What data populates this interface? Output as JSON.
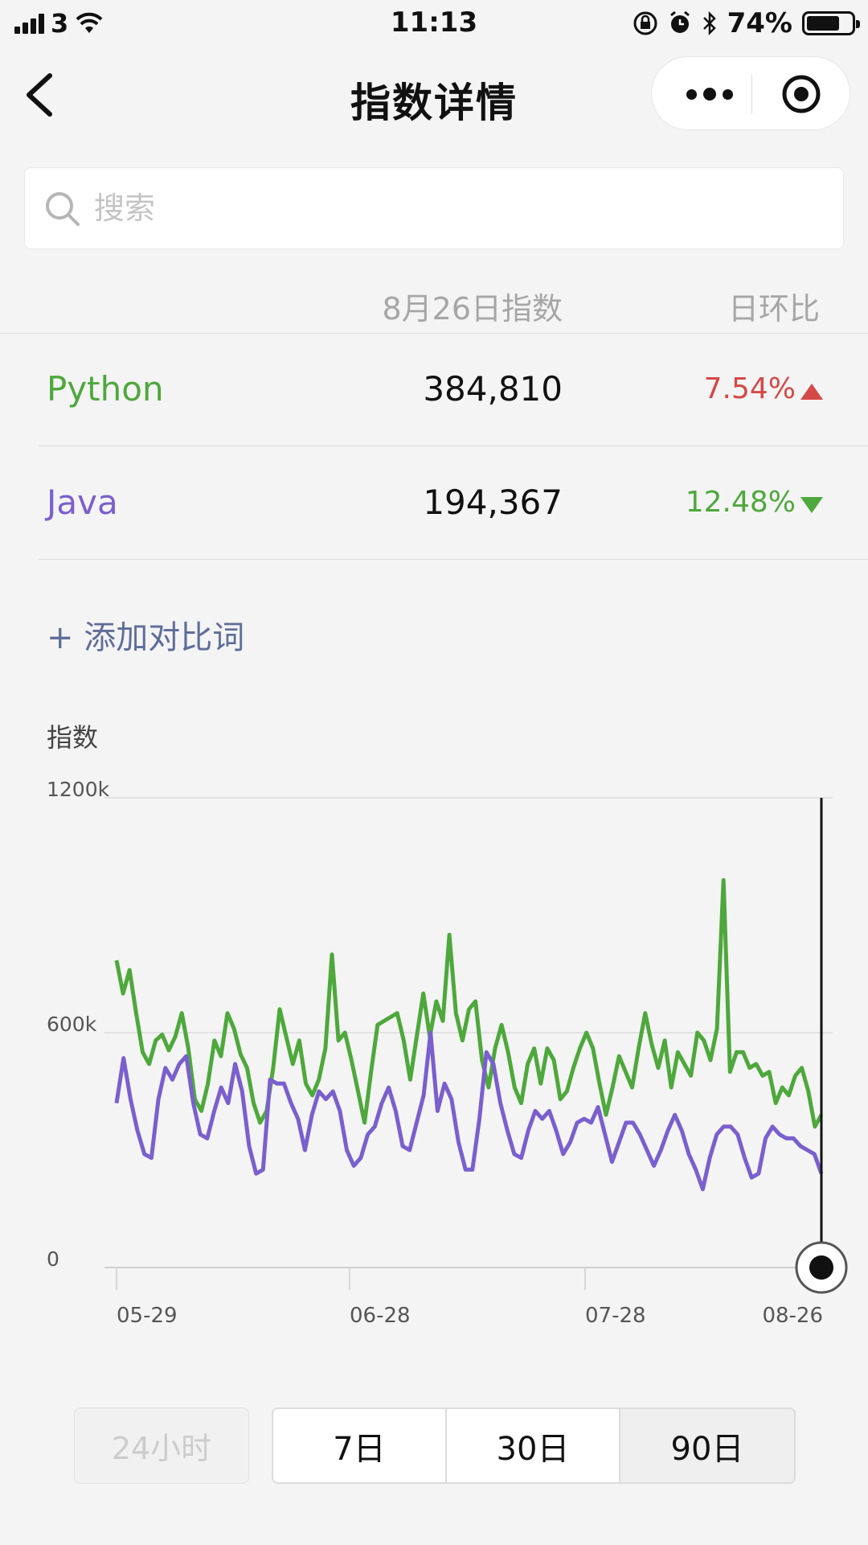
{
  "status_bar": {
    "carrier": "3",
    "time": "11:13",
    "battery": "74%"
  },
  "nav": {
    "title": "指数详情"
  },
  "search": {
    "placeholder": "搜索"
  },
  "table": {
    "header_index": "8月26日指数",
    "header_change": "日环比",
    "rows": [
      {
        "name": "Python",
        "value": "384,810",
        "change": "7.54%",
        "direction": "up",
        "color": "#4ea83c",
        "change_color": "#d34a47"
      },
      {
        "name": "Java",
        "value": "194,367",
        "change": "12.48%",
        "direction": "down",
        "color": "#7a5fce",
        "change_color": "#4ea83c"
      }
    ]
  },
  "add_compare": "+ 添加对比词",
  "chart_data": {
    "type": "line",
    "ylabel": "指数",
    "y_ticks": [
      "1200k",
      "600k",
      "0"
    ],
    "ylim": [
      0,
      1200000
    ],
    "x_ticks": [
      "05-29",
      "06-28",
      "07-28",
      "08-26"
    ],
    "grid": true,
    "series": [
      {
        "name": "Python",
        "color": "#4ea83c",
        "values": [
          785000,
          700000,
          760000,
          650000,
          550000,
          520000,
          580000,
          595000,
          555000,
          590000,
          650000,
          560000,
          430000,
          400000,
          470000,
          580000,
          540000,
          650000,
          610000,
          545000,
          510000,
          420000,
          370000,
          400000,
          510000,
          660000,
          590000,
          520000,
          580000,
          470000,
          440000,
          480000,
          560000,
          800000,
          580000,
          600000,
          530000,
          450000,
          370000,
          500000,
          620000,
          630000,
          640000,
          650000,
          580000,
          480000,
          590000,
          700000,
          590000,
          680000,
          630000,
          850000,
          650000,
          580000,
          660000,
          680000,
          530000,
          460000,
          560000,
          620000,
          550000,
          460000,
          420000,
          520000,
          560000,
          470000,
          560000,
          530000,
          430000,
          450000,
          510000,
          560000,
          600000,
          560000,
          470000,
          390000,
          460000,
          540000,
          500000,
          460000,
          560000,
          650000,
          570000,
          510000,
          580000,
          460000,
          550000,
          520000,
          490000,
          600000,
          580000,
          530000,
          610000,
          990000,
          500000,
          550000,
          550000,
          510000,
          520000,
          490000,
          500000,
          420000,
          460000,
          440000,
          490000,
          510000,
          450000,
          360000,
          390000
        ]
      },
      {
        "name": "Java",
        "color": "#7a5fce",
        "values": [
          420000,
          535000,
          430000,
          350000,
          290000,
          280000,
          430000,
          510000,
          480000,
          520000,
          540000,
          420000,
          340000,
          330000,
          400000,
          460000,
          420000,
          520000,
          450000,
          310000,
          240000,
          250000,
          480000,
          470000,
          470000,
          420000,
          380000,
          300000,
          390000,
          450000,
          430000,
          450000,
          400000,
          300000,
          260000,
          280000,
          340000,
          360000,
          420000,
          460000,
          400000,
          310000,
          300000,
          370000,
          440000,
          600000,
          400000,
          470000,
          430000,
          320000,
          250000,
          250000,
          380000,
          550000,
          520000,
          420000,
          350000,
          290000,
          280000,
          350000,
          400000,
          380000,
          400000,
          350000,
          290000,
          320000,
          370000,
          380000,
          370000,
          410000,
          340000,
          270000,
          320000,
          370000,
          370000,
          340000,
          300000,
          260000,
          300000,
          350000,
          390000,
          350000,
          290000,
          250000,
          200000,
          280000,
          340000,
          360000,
          360000,
          340000,
          280000,
          230000,
          240000,
          330000,
          360000,
          340000,
          330000,
          330000,
          310000,
          300000,
          290000,
          240000
        ]
      }
    ]
  }
}
